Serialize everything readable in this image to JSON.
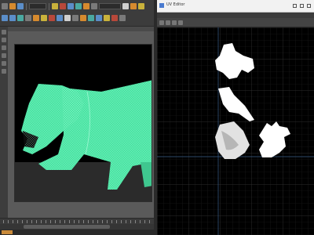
{
  "left_app": {
    "viewport_overlay_text": "",
    "accent_green": "#49e3a3",
    "shelf_icons": [
      "move-icon",
      "rotate-icon",
      "scale-icon",
      "select-icon",
      "lasso-icon",
      "paint-icon",
      "snap-icon",
      "camera-icon",
      "render-icon",
      "light-icon"
    ]
  },
  "uv_editor": {
    "window_title": "UV Editor",
    "uv_fill_color": "#ffffff",
    "grid_color": "#1f1f1f",
    "shells": [
      "head-shell",
      "torso-shell",
      "leg-shell",
      "tail-shell"
    ]
  },
  "colors": {
    "mesh": "#49e3a3",
    "viewport_bg": "#000000",
    "panel": "#444444"
  }
}
